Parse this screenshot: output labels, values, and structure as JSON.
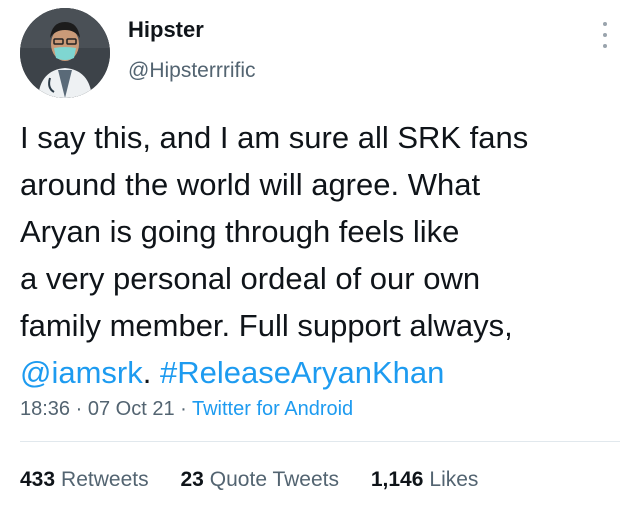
{
  "user": {
    "name": "Hipster",
    "handle": "@Hipsterrrific"
  },
  "tweet": {
    "lines": [
      "I say this, and I am sure all SRK fans",
      "around the world will agree. What",
      "Aryan is going through feels like",
      "a very personal ordeal of our own",
      "family member. Full support always,"
    ],
    "mention": "@iamsrk",
    "after_mention": ". ",
    "hashtag": "#ReleaseAryanKhan"
  },
  "meta": {
    "time": "18:36",
    "sep1": " · ",
    "date": "07 Oct 21",
    "sep2": " · ",
    "source": "Twitter for Android"
  },
  "stats": [
    {
      "count": "433",
      "label": "Retweets"
    },
    {
      "count": "23",
      "label": "Quote Tweets"
    },
    {
      "count": "1,146",
      "label": "Likes"
    }
  ],
  "icons": {
    "more": "more-vertical-icon",
    "avatar": "profile-photo"
  },
  "colors": {
    "link": "#1d9bf0",
    "secondary": "#536471",
    "primary": "#0f1419"
  }
}
